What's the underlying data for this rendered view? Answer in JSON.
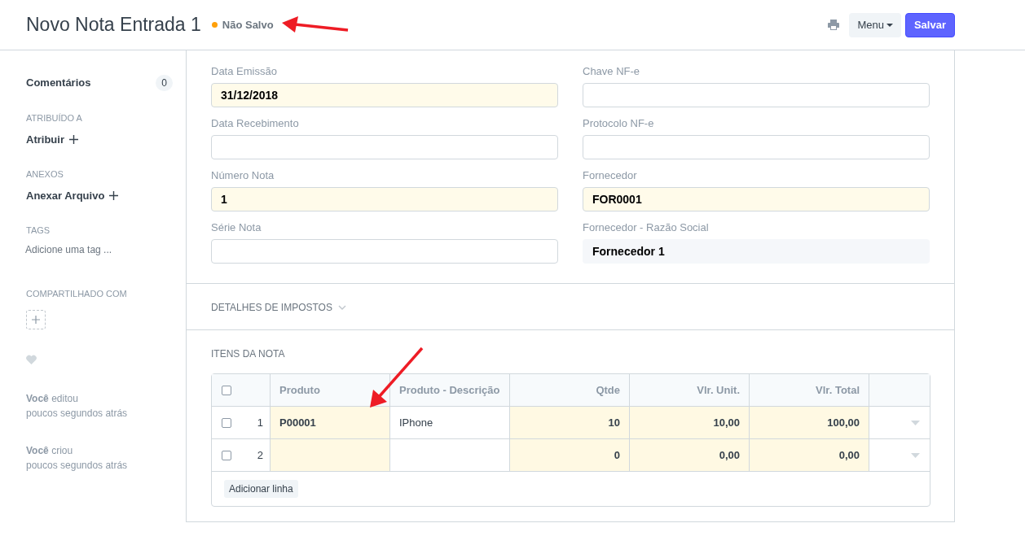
{
  "header": {
    "title": "Novo Nota Entrada 1",
    "status": {
      "label": "Não Salvo",
      "color": "#ffa00a"
    },
    "menu_button": "Menu",
    "save_button": "Salvar"
  },
  "sidebar": {
    "comments": {
      "label": "Comentários",
      "count": "0"
    },
    "sections": [
      {
        "heading": "ATRIBUÍDO A",
        "action": "Atribuir"
      },
      {
        "heading": "ANEXOS",
        "action": "Anexar Arquivo"
      }
    ],
    "tags": {
      "heading": "TAGS",
      "placeholder": "Adicione uma tag ..."
    },
    "shared": {
      "heading": "COMPARTILHADO COM"
    },
    "liked": false,
    "activity": [
      {
        "text": "**Você** editou",
        "time": "poucos segundos atrás"
      },
      {
        "text": "**Você** criou",
        "time": "poucos segundos atrás"
      }
    ]
  },
  "form": {
    "fields": [
      {
        "label": "Data Emissão",
        "value": "31/12/2018",
        "kind": "mandatory"
      },
      {
        "label": "Chave NF-e",
        "kind": "input"
      },
      {
        "label": "Data Recebimento",
        "kind": "input"
      },
      {
        "label": "Protocolo NF-e",
        "kind": "input"
      },
      {
        "label": "Número Nota",
        "value": "1",
        "kind": "mandatory"
      },
      {
        "label": "Fornecedor",
        "value": "FOR0001",
        "kind": "mandatory"
      },
      {
        "label": "Série Nota",
        "kind": "input"
      },
      {
        "label": "Fornecedor - Razão Social",
        "value": "Fornecedor 1",
        "kind": "readonly"
      }
    ],
    "sections": [
      {
        "title": "DETALHES DE IMPOSTOS",
        "expanded": false
      },
      {
        "title": "ITENS DA NOTA",
        "expanded": true
      }
    ]
  },
  "items_table": {
    "all_selected": false,
    "columns": [
      {
        "label": "Produto",
        "numeric": false,
        "mandatory": true
      },
      {
        "label": "Produto - Descrição",
        "numeric": false,
        "mandatory": false
      },
      {
        "label": "Qtde",
        "numeric": true,
        "mandatory": true
      },
      {
        "label": "Vlr. Unit.",
        "numeric": true,
        "mandatory": true
      },
      {
        "label": "Vlr. Total",
        "numeric": true,
        "mandatory": true
      }
    ],
    "rows": [
      {
        "index": "1",
        "selected": false,
        "cells": [
          "P00001",
          "IPhone",
          "10",
          "10,00",
          "100,00"
        ]
      },
      {
        "index": "2",
        "selected": false,
        "cells": [
          "",
          "",
          "0",
          "0,00",
          "0,00"
        ]
      }
    ],
    "add_row_button": "Adicionar linha"
  }
}
